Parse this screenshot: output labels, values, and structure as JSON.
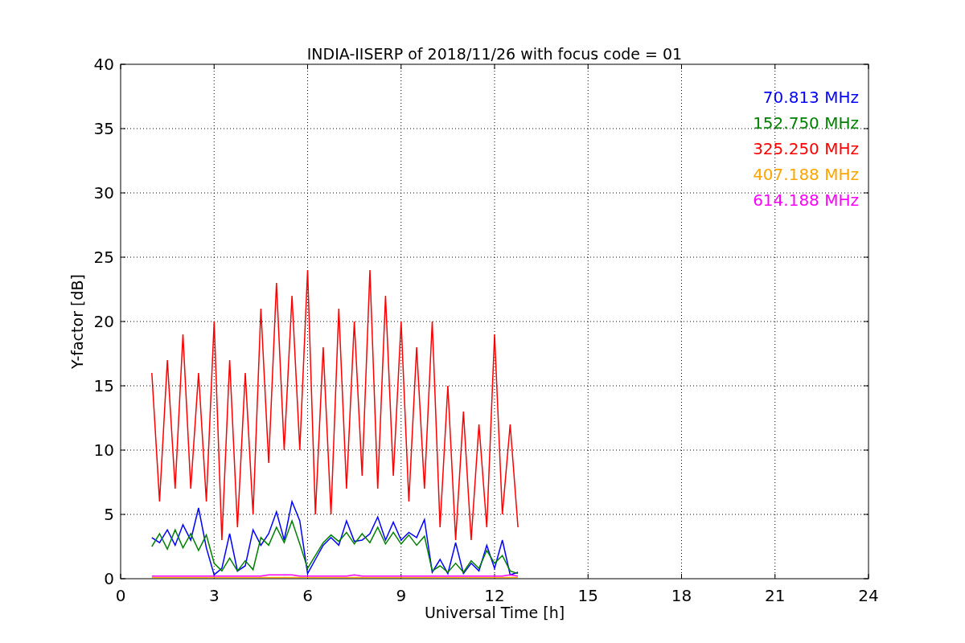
{
  "chart": {
    "chart_data": {
      "type": "line",
      "grid": true,
      "title": "INDIA-IISERP of 2018/11/26 with focus code = 01",
      "xlabel": "Universal Time [h]",
      "ylabel": "Y-factor [dB]",
      "xlim": [
        0,
        24
      ],
      "ylim": [
        0,
        40
      ],
      "xticks": [
        0,
        3,
        6,
        9,
        12,
        15,
        18,
        21,
        24
      ],
      "yticks": [
        0,
        5,
        10,
        15,
        20,
        25,
        30,
        35,
        40
      ],
      "x": [
        1,
        1.25,
        1.5,
        1.75,
        2,
        2.25,
        2.5,
        2.75,
        3,
        3.25,
        3.5,
        3.75,
        4,
        4.25,
        4.5,
        4.75,
        5,
        5.25,
        5.5,
        5.75,
        6,
        6.25,
        6.5,
        6.75,
        7,
        7.25,
        7.5,
        7.75,
        8,
        8.25,
        8.5,
        8.75,
        9,
        9.25,
        9.5,
        9.75,
        10,
        10.25,
        10.5,
        10.75,
        11,
        11.25,
        11.5,
        11.75,
        12,
        12.25,
        12.5,
        12.75
      ],
      "series": [
        {
          "name": "70.813 MHz",
          "color": "#0000ff",
          "values": [
            3.2,
            2.8,
            3.8,
            2.6,
            4.2,
            3.0,
            5.5,
            2.4,
            0.3,
            0.8,
            3.5,
            0.6,
            1.0,
            3.8,
            2.6,
            3.5,
            5.2,
            3.0,
            6.0,
            4.5,
            0.4,
            1.5,
            2.6,
            3.2,
            2.6,
            4.5,
            2.9,
            3.0,
            3.5,
            4.8,
            3.0,
            4.4,
            3.0,
            3.6,
            3.2,
            4.6,
            0.5,
            1.5,
            0.4,
            2.8,
            0.4,
            1.2,
            0.6,
            2.6,
            0.8,
            3.0,
            0.3,
            0.5
          ]
        },
        {
          "name": "152.750 MHz",
          "color": "#008000",
          "values": [
            2.5,
            3.5,
            2.3,
            3.8,
            2.4,
            3.5,
            2.2,
            3.4,
            1.2,
            0.6,
            1.6,
            0.6,
            1.4,
            0.7,
            3.2,
            2.6,
            4.0,
            2.8,
            4.5,
            2.7,
            0.8,
            1.8,
            2.8,
            3.4,
            2.9,
            3.6,
            2.7,
            3.5,
            2.8,
            4.0,
            2.7,
            3.6,
            2.7,
            3.4,
            2.6,
            3.3,
            0.6,
            1.0,
            0.5,
            1.2,
            0.5,
            1.4,
            0.8,
            2.2,
            1.2,
            1.8,
            0.6,
            0.4
          ]
        },
        {
          "name": "325.250 MHz",
          "color": "#ff0000",
          "values": [
            16,
            6,
            17,
            7,
            19,
            7,
            16,
            6,
            20,
            3,
            17,
            4,
            16,
            5,
            21,
            9,
            23,
            10,
            22,
            10,
            24,
            5,
            18,
            5,
            21,
            7,
            20,
            8,
            24,
            7,
            22,
            8,
            20,
            6,
            18,
            7,
            20,
            4,
            15,
            3,
            13,
            3,
            12,
            4,
            19,
            5,
            12,
            4
          ]
        },
        {
          "name": "407.188 MHz",
          "color": "#ffa500",
          "values": [
            0.1,
            0.1,
            0.1,
            0.1,
            0.1,
            0.1,
            0.1,
            0.1,
            0.1,
            0.1,
            0.1,
            0.1,
            0.1,
            0.1,
            0.1,
            0.1,
            0.1,
            0.1,
            0.1,
            0.1,
            0.1,
            0.1,
            0.1,
            0.1,
            0.1,
            0.1,
            0.1,
            0.1,
            0.1,
            0.1,
            0.1,
            0.1,
            0.1,
            0.1,
            0.1,
            0.1,
            0.1,
            0.1,
            0.1,
            0.1,
            0.1,
            0.1,
            0.1,
            0.1,
            0.1,
            0.1,
            0.1,
            0.1
          ]
        },
        {
          "name": "614.188 MHz",
          "color": "#ff00ff",
          "values": [
            0.2,
            0.2,
            0.2,
            0.2,
            0.2,
            0.2,
            0.2,
            0.2,
            0.2,
            0.2,
            0.2,
            0.2,
            0.2,
            0.2,
            0.2,
            0.3,
            0.3,
            0.3,
            0.3,
            0.2,
            0.2,
            0.2,
            0.2,
            0.2,
            0.2,
            0.2,
            0.3,
            0.2,
            0.2,
            0.2,
            0.2,
            0.2,
            0.2,
            0.2,
            0.2,
            0.2,
            0.2,
            0.2,
            0.2,
            0.2,
            0.2,
            0.2,
            0.2,
            0.2,
            0.2,
            0.2,
            0.3,
            0.2
          ]
        }
      ]
    }
  }
}
